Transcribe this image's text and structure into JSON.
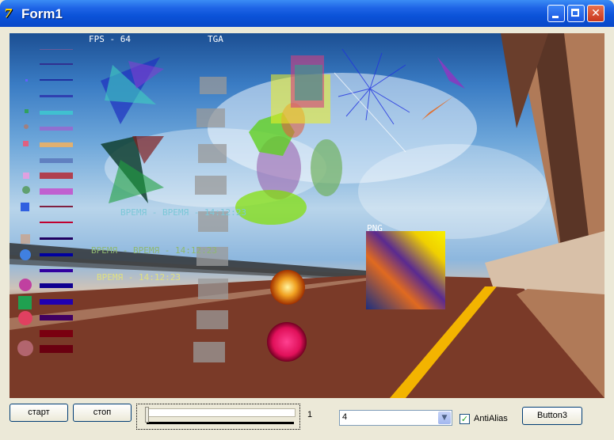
{
  "window": {
    "title": "Form1",
    "icon": "delphi-icon"
  },
  "title_buttons": {
    "minimize": "minimize-icon",
    "maximize": "maximize-icon",
    "close": "close-icon",
    "close_glyph": "✕"
  },
  "hud": {
    "fps": "FPS - 64",
    "tga": "TGA",
    "png": "PNG",
    "time_a": "ВРЕМЯ - ВРЕМЯ - 14:12:23",
    "time_b": "ВРЕМЯ - ВРЕМЯ - 14:12:23",
    "time_c": "ВРЕМЯ - 14:12:23"
  },
  "controls": {
    "start": "старт",
    "stop": "стоп",
    "track_value": "1",
    "combo_value": "4",
    "antialias_label": "AntiAlias",
    "antialias_checked": true,
    "button3": "Button3"
  },
  "colors": {
    "titlebar": "#0a48c8",
    "face": "#ece9d8",
    "accent": "#003c74"
  }
}
